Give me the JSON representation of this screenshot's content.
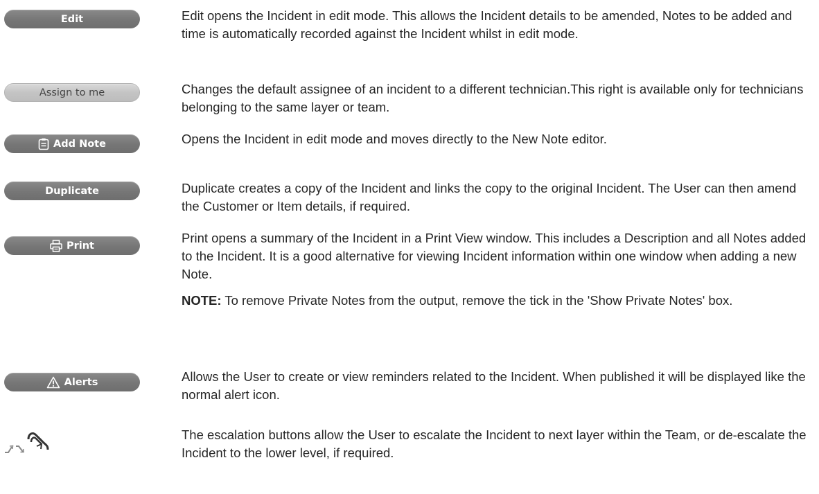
{
  "items": [
    {
      "button": "Edit",
      "icon": null,
      "text": [
        "Edit opens the Incident in edit mode. This allows the Incident details to be amended, Notes to be added and time is automatically recorded against the Incident whilst in edit mode."
      ]
    },
    {
      "button": "Assign to me",
      "icon": null,
      "text": [
        "Changes the default assignee of an incident to a different technician.This right is available only for technicians belonging to the same layer or team."
      ]
    },
    {
      "button": "Add Note",
      "icon": "note-icon",
      "text": [
        "Opens the Incident in edit mode and moves directly to the New Note editor."
      ]
    },
    {
      "button": "Duplicate",
      "icon": null,
      "text": [
        "Duplicate creates a copy of the Incident and links the copy to the original Incident. The User can then amend the Customer or Item details, if required."
      ]
    },
    {
      "button": "Print",
      "icon": "printer-icon",
      "text": [
        "Print opens a summary of the Incident in a Print View window. This includes a Description and all Notes added to the Incident. It is a good alternative for viewing Incident information within one window when adding a new Note."
      ],
      "note_label": "NOTE:",
      "note_text": " To remove Private Notes from the output, remove the tick in the 'Show Private Notes' box."
    },
    {
      "button": "Alerts",
      "icon": "warning-triangle-icon",
      "text": [
        "Allows the User to create or view reminders related to the Incident. When published it will be displayed like the normal alert icon."
      ]
    },
    {
      "button": null,
      "icon": "escalation-icons",
      "text": [
        "The escalation buttons allow the User to escalate the Incident to next layer within the Team, or de-escalate the Incident to the lower level, if required."
      ]
    }
  ]
}
